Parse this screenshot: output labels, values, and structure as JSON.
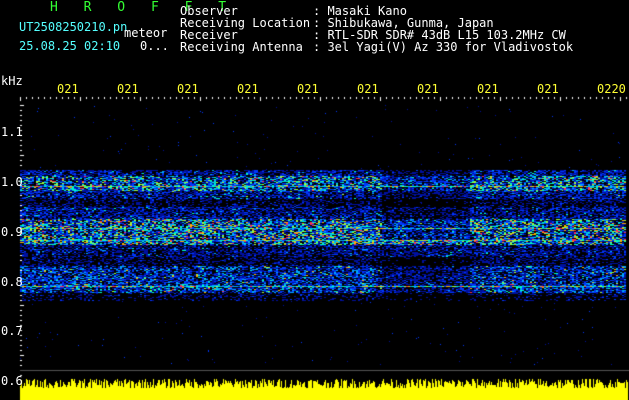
{
  "header": {
    "program": "H R O F F T",
    "filename": "UT2508250210.pn",
    "mode": "meteor",
    "date_time": "25.08.25 02:10",
    "counter": "0...",
    "info_labels": [
      "Observer",
      "Receiving Location",
      "Receiver",
      "Receiving Antenna"
    ],
    "info_values": [
      ": Masaki Kano",
      ": Shibukawa, Gunma, Japan",
      ": RTL-SDR SDR# 43dB L15 103.2MHz CW",
      ": 3el Yagi(V) Az 330 for Vladivostok"
    ]
  },
  "axes": {
    "unit": "kHz",
    "time_ticks": [
      "021",
      "021",
      "021",
      "021",
      "021",
      "021",
      "021",
      "021",
      "021",
      "0220"
    ],
    "freq_ticks": [
      "1.1",
      "1.0",
      "0.9",
      "0.8",
      "0.7",
      "0.6"
    ]
  },
  "colors": {
    "background": "#000000",
    "tick_yellow": "#ffff33",
    "title_green": "#33ff33",
    "label_cyan": "#55ffff",
    "signal_bars": "#ffff00"
  }
}
